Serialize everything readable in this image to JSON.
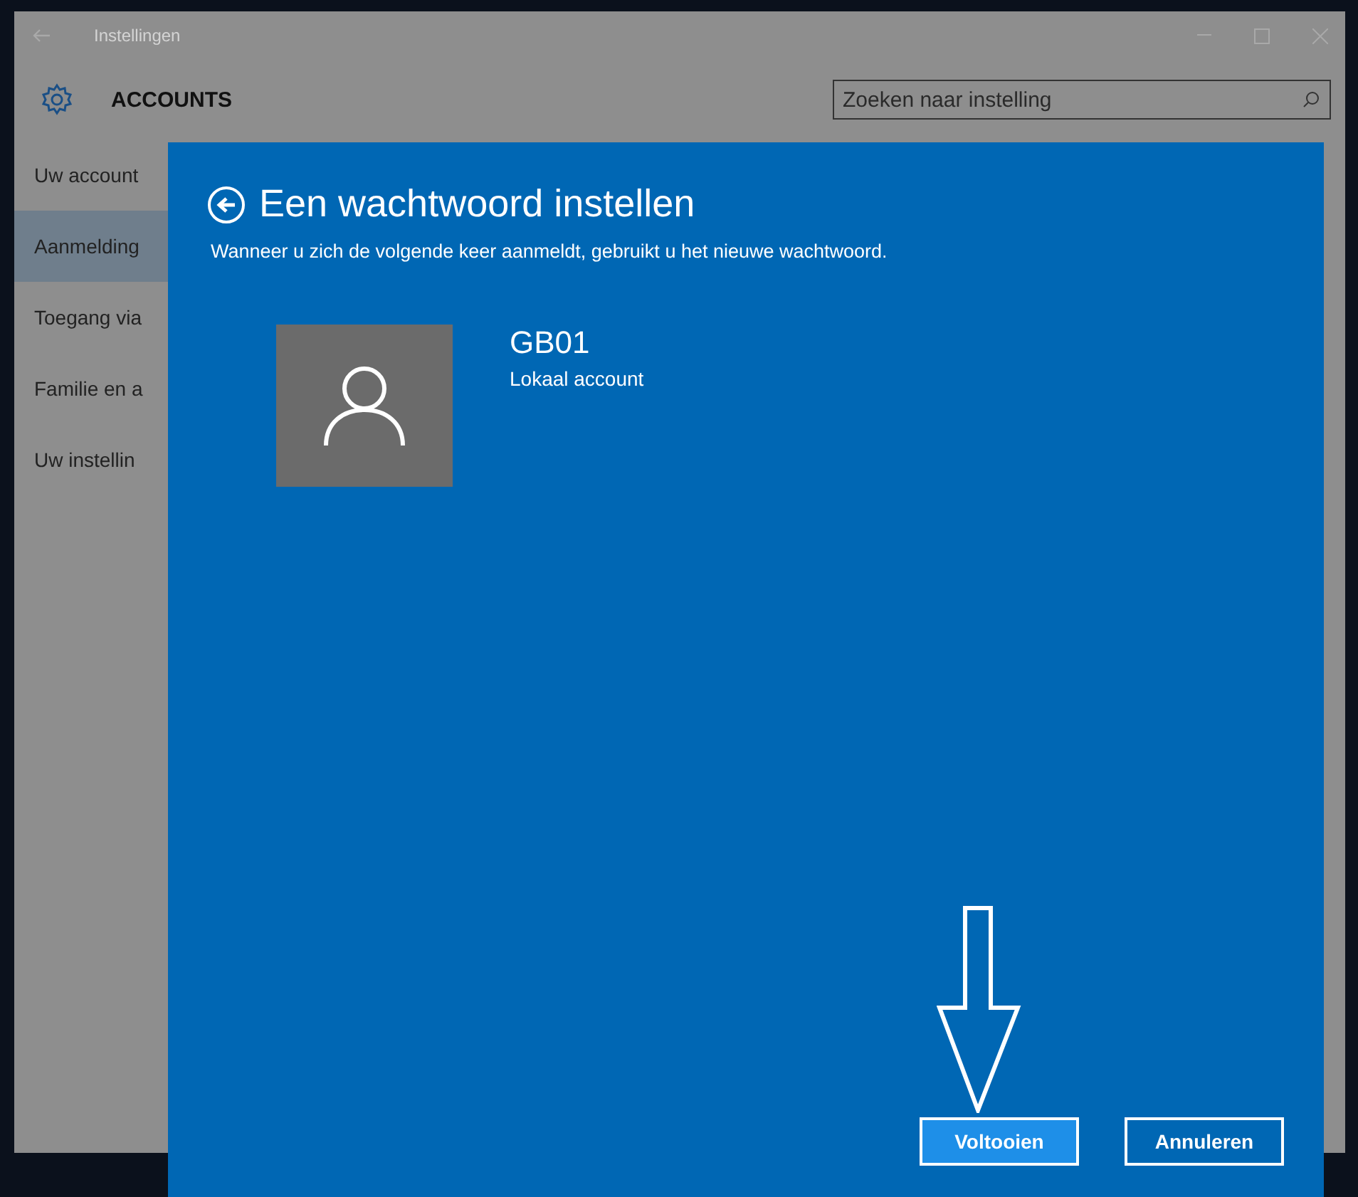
{
  "window": {
    "title": "Instellingen",
    "section": "ACCOUNTS"
  },
  "search": {
    "placeholder": "Zoeken naar instelling"
  },
  "sidebar": {
    "items": [
      {
        "label": "Uw account",
        "selected": false
      },
      {
        "label": "Aanmelding",
        "selected": true
      },
      {
        "label": "Toegang via",
        "selected": false
      },
      {
        "label": "Familie en a",
        "selected": false
      },
      {
        "label": "Uw instellin",
        "selected": false
      }
    ]
  },
  "dialog": {
    "title": "Een wachtwoord instellen",
    "subtitle": "Wanneer u zich de volgende keer aanmeldt, gebruikt u het nieuwe wachtwoord.",
    "account_name": "GB01",
    "account_type": "Lokaal account",
    "buttons": [
      {
        "label": "Voltooien",
        "selected": true
      },
      {
        "label": "Annuleren",
        "selected": false
      }
    ]
  }
}
